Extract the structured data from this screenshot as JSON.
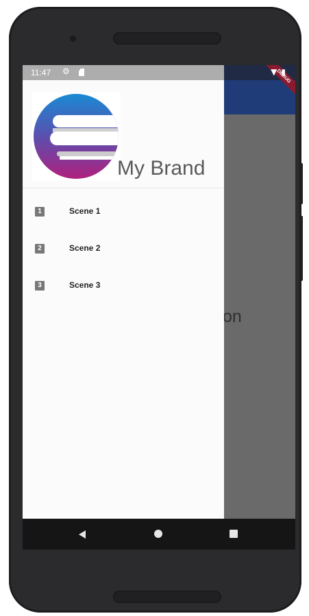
{
  "status_bar": {
    "time": "11:47",
    "left_icons": [
      "settings-icon",
      "sd-card-icon"
    ],
    "right_icons": [
      "wifi-icon",
      "battery-icon"
    ]
  },
  "debug_banner": "DEBUG",
  "background": {
    "partial_text": "on"
  },
  "drawer": {
    "brand": "My Brand",
    "logo_icon": "brand-logo-icon",
    "items": [
      {
        "icon_glyph": "1",
        "label": "Scene 1"
      },
      {
        "icon_glyph": "2",
        "label": "Scene 2"
      },
      {
        "icon_glyph": "3",
        "label": "Scene 3"
      }
    ]
  },
  "colors": {
    "app_bar": "#1f3c78",
    "drawer_bg": "#fbfbfb",
    "logo_gradient_top": "#1a8ad4",
    "logo_gradient_bottom": "#b0207e"
  }
}
